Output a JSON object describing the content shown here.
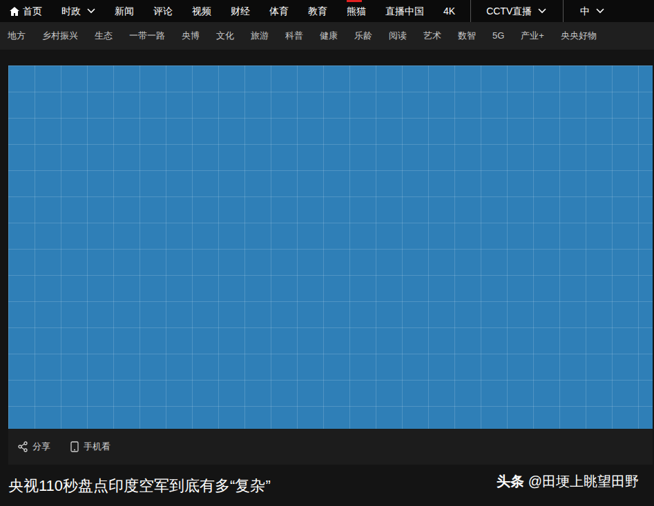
{
  "top_nav": {
    "items": [
      {
        "label": "首页",
        "kind": "home",
        "marked": false
      },
      {
        "label": "时政",
        "kind": "dropdown",
        "marked": false
      },
      {
        "label": "新闻",
        "kind": "link",
        "marked": false
      },
      {
        "label": "评论",
        "kind": "link",
        "marked": false
      },
      {
        "label": "视频",
        "kind": "link",
        "marked": false
      },
      {
        "label": "财经",
        "kind": "link",
        "marked": false
      },
      {
        "label": "体育",
        "kind": "link",
        "marked": false
      },
      {
        "label": "教育",
        "kind": "link",
        "marked": false
      },
      {
        "label": "熊猫",
        "kind": "link",
        "marked": true
      },
      {
        "label": "直播中国",
        "kind": "link",
        "marked": false
      },
      {
        "label": "4K",
        "kind": "link",
        "marked": false
      },
      {
        "label": "CCTV直播",
        "kind": "dropdown",
        "marked": false
      },
      {
        "label": "中",
        "kind": "dropdown",
        "marked": false
      }
    ]
  },
  "sub_nav": {
    "items": [
      "地方",
      "乡村振兴",
      "生态",
      "一带一路",
      "央博",
      "文化",
      "旅游",
      "科普",
      "健康",
      "乐龄",
      "阅读",
      "艺术",
      "数智",
      "5G",
      "产业+",
      "央央好物"
    ]
  },
  "video_toolbar": {
    "share": "分享",
    "mobile": "手机看"
  },
  "title": "央视110秒盘点印度空军到底有多“复杂”",
  "watermark": {
    "brand": "头条",
    "handle": "@田埂上眺望田野"
  }
}
